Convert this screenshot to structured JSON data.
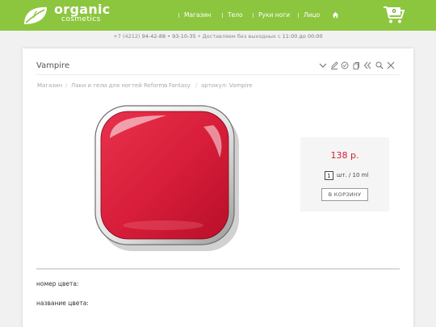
{
  "header": {
    "logo": {
      "word": "organic",
      "sub": "cosmetics"
    },
    "nav": [
      {
        "label": "Магазин"
      },
      {
        "label": "Тело"
      },
      {
        "label": "Руки ноги"
      },
      {
        "label": "Лицо"
      }
    ],
    "home_icon": "home-icon",
    "cart": {
      "count": "0",
      "icon": "cart-icon"
    },
    "colors": {
      "bar": "#8cc63f"
    }
  },
  "infoline": {
    "prefix": "+7 (4212)",
    "phones": "94-42-88 • 93-10-35",
    "middle": "• Доставляем без выходных с",
    "hours": "11:00 до 00:00"
  },
  "product": {
    "title": "Vampire",
    "tools": [
      "chevron-down-icon",
      "pencil-icon",
      "check-circle-icon",
      "copy-icon",
      "double-chevron-left-icon",
      "search-icon",
      "close-icon"
    ],
    "breadcrumb": [
      {
        "label": "Магазин"
      },
      {
        "label": "Лаки и гели для ногтей Reforma"
      },
      {
        "label": "Fantasy"
      },
      {
        "label": "артикул: Vampire"
      }
    ],
    "swatch_color": "#d81e3a",
    "price": "138 р.",
    "quantity": "1",
    "unit": "шт. / 10 ml",
    "buy_label": "В КОРЗИНУ",
    "properties": [
      {
        "label": "номер цвета:"
      },
      {
        "label": "название цвета:"
      }
    ]
  }
}
